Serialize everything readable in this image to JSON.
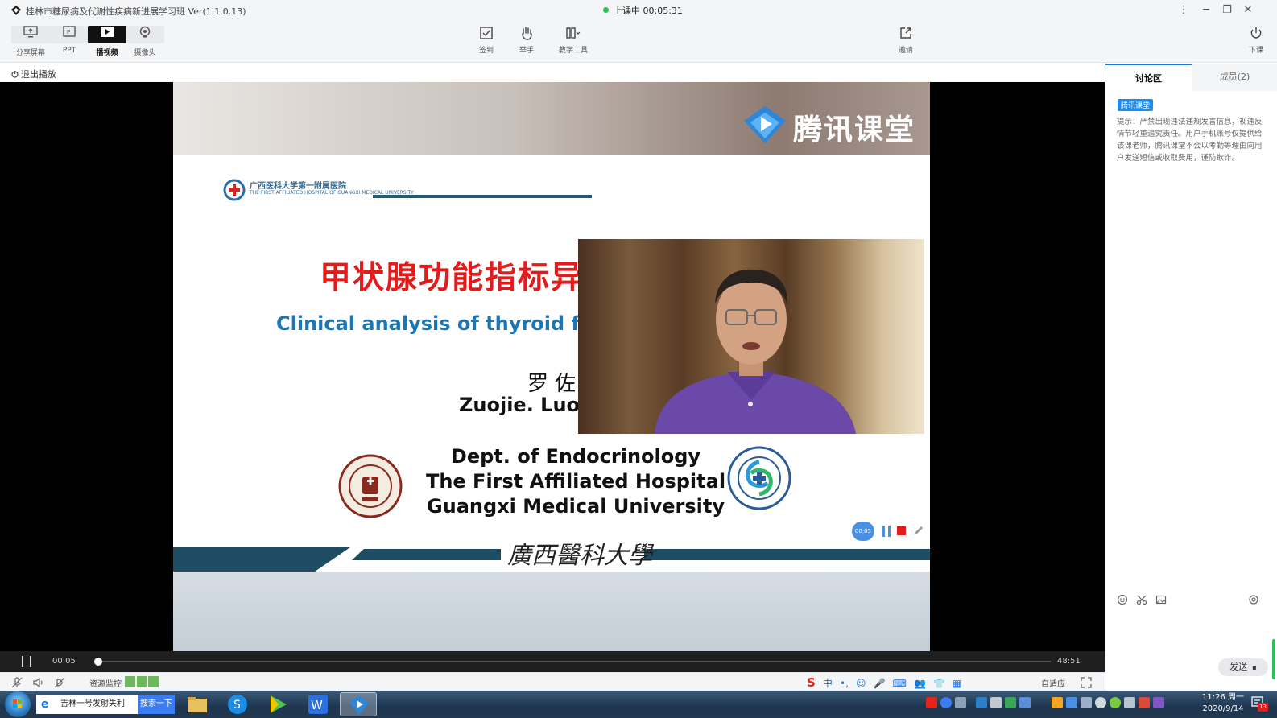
{
  "window": {
    "title": "桂林市糖尿病及代谢性疾病新进展学习班 Ver(1.1.0.13)",
    "status_label": "上课中 00:05:31",
    "status_color": "#2cc15a"
  },
  "toolbar": {
    "left_tools": [
      {
        "label": "分享屏幕",
        "icon": "share-screen-icon"
      },
      {
        "label": "PPT",
        "icon": "ppt-icon"
      },
      {
        "label": "播视频",
        "icon": "play-video-icon",
        "active": true
      },
      {
        "label": "摄像头",
        "icon": "camera-icon"
      }
    ],
    "center_tools": [
      {
        "label": "签到",
        "icon": "checkin-icon"
      },
      {
        "label": "举手",
        "icon": "raise-hand-icon"
      },
      {
        "label": "教学工具",
        "icon": "teaching-tools-icon"
      }
    ],
    "invite_label": "邀请",
    "end_class_label": "下课"
  },
  "subbar": {
    "exit_play_label": "退出播放"
  },
  "slide": {
    "brand_text": "腾讯课堂",
    "hospital_name_cn": "广西医科大学第一附属医院",
    "hospital_name_en": "THE FIRST AFFILIATED HOSPITAL OF GUANGXI MEDICAL UNIVERSITY",
    "title_cn": "甲状腺功能指标异",
    "title_en": "Clinical analysis of thyroid fun",
    "speaker_cn": "罗佐杰",
    "speaker_en": "Zuojie. Luo   M.D./Ph.D.",
    "dept_lines": [
      "Dept. of Endocrinology",
      "The First Affiliated Hospital",
      "Guangxi Medical University"
    ],
    "calligraphy": "廣西醫科大學",
    "accent_color": "#1e4d63",
    "title_color": "#e31b1b",
    "subtitle_color": "#1b76b6"
  },
  "recorder": {
    "timer_label": "00:05"
  },
  "playback": {
    "current": "00:05",
    "total": "48:51",
    "progress_fraction": 0.0017
  },
  "status_strip": {
    "resource_monitor_label": "资源监控",
    "ime_chars": [
      "中",
      "•,",
      "☺",
      "🎤",
      "⌨",
      "👥",
      "👕",
      "▦"
    ],
    "fit_label": "自适应"
  },
  "panel": {
    "tabs": [
      {
        "label": "讨论区",
        "active": true
      },
      {
        "label": "成员(2)",
        "active": false
      }
    ],
    "tag": "腾讯课堂",
    "notice": "提示：严禁出现违法违规发言信息，视违反情节轻重追究责任。用户手机账号仅提供给该课老师，腾讯课堂不会以考勤等理由向用户发送短信或收取费用，谨防欺诈。",
    "send_label": "发送"
  },
  "taskbar": {
    "search_text": "吉林一号发射失利",
    "search_button": "搜索一下",
    "time": "11:26 周一",
    "date": "2020/9/14",
    "notif_count": "13"
  }
}
